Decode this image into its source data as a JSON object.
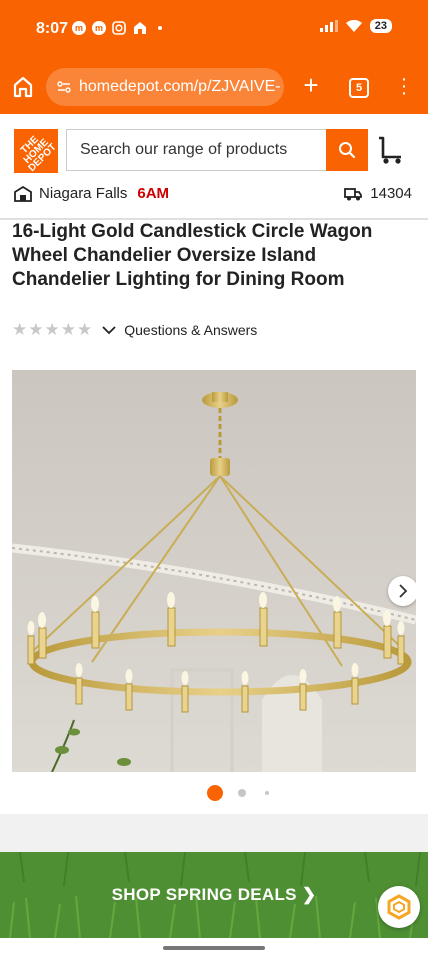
{
  "status_bar": {
    "time": "8:07",
    "notification_icons": [
      "messenger-icon",
      "messenger-icon",
      "instagram-icon",
      "home-app-icon"
    ],
    "battery": "23"
  },
  "browser": {
    "url": "homedepot.com/p/ZJVAIVE-",
    "tab_count": "5"
  },
  "header": {
    "logo_text": "THE HOME DEPOT",
    "search_placeholder": "Search our range of products",
    "store_name": "Niagara Falls",
    "store_hours": "6AM",
    "delivery_zip": "14304"
  },
  "product": {
    "title": "16-Light Gold Candlestick Circle Wagon Wheel Chandelier Oversize Island Chandelier Lighting for Dining Room",
    "rating_stars": 0,
    "qa_label": "Questions & Answers"
  },
  "gallery": {
    "image_count_dots": 3,
    "active_index": 0
  },
  "promo": {
    "label": "SHOP SPRING DEALS ❯"
  },
  "colors": {
    "brand_orange": "#f96302",
    "promo_green": "#4a8a2e",
    "store_hours_red": "#cc0000"
  }
}
